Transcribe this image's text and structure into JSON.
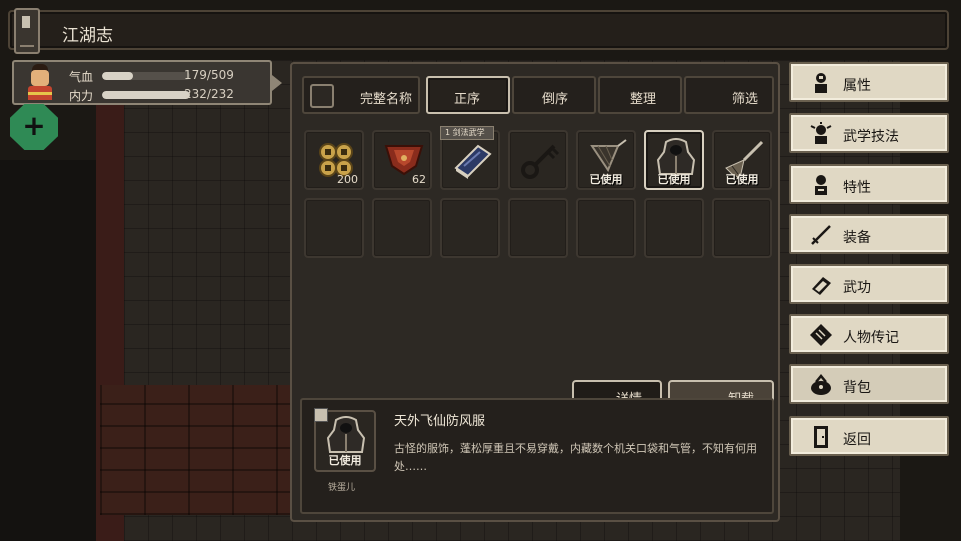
{
  "header": {
    "title": "江湖志"
  },
  "character": {
    "hp_label": "气血",
    "hp_value": "179/509",
    "hp_fraction": 0.35,
    "mp_label": "内力",
    "mp_value": "232/232",
    "mp_fraction": 1.0,
    "add_label": "+"
  },
  "inventory": {
    "sort_tabs": [
      {
        "label": "完整名称"
      },
      {
        "label": "正序"
      },
      {
        "label": "倒序"
      },
      {
        "label": "整理"
      },
      {
        "label": "筛选"
      }
    ],
    "items": [
      {
        "icon": "copper-coins-icon",
        "count": "200",
        "status": ""
      },
      {
        "icon": "red-collar-armor-icon",
        "count": "62",
        "status": ""
      },
      {
        "icon": "martial-manual-book-icon",
        "count": "",
        "status": "",
        "tag": "1 剑法武学"
      },
      {
        "icon": "iron-key-icon",
        "count": "",
        "status": ""
      },
      {
        "icon": "fishing-net-icon",
        "count": "",
        "status": "已使用"
      },
      {
        "icon": "hooded-robe-icon",
        "count": "",
        "status": "已使用"
      },
      {
        "icon": "whisk-brush-icon",
        "count": "",
        "status": "已使用"
      }
    ],
    "detail_button": "详情",
    "unequip_button": "卸载",
    "selected": {
      "name": "天外飞仙防风服",
      "status": "已使用",
      "owner": "铁蛋儿",
      "description": "古怪的服饰，蓬松厚重且不易穿戴，内藏数个机关口袋和气管，不知有何用处……"
    }
  },
  "menu": [
    {
      "label": "属性",
      "icon": "character-attributes-icon"
    },
    {
      "label": "武学技法",
      "icon": "martial-technique-icon"
    },
    {
      "label": "特性",
      "icon": "character-trait-icon"
    },
    {
      "label": "装备",
      "icon": "sword-equipment-icon"
    },
    {
      "label": "武功",
      "icon": "martial-book-icon"
    },
    {
      "label": "人物传记",
      "icon": "biography-scroll-icon"
    },
    {
      "label": "背包",
      "icon": "backpack-bag-icon"
    },
    {
      "label": "返回",
      "icon": "door-return-icon"
    }
  ]
}
